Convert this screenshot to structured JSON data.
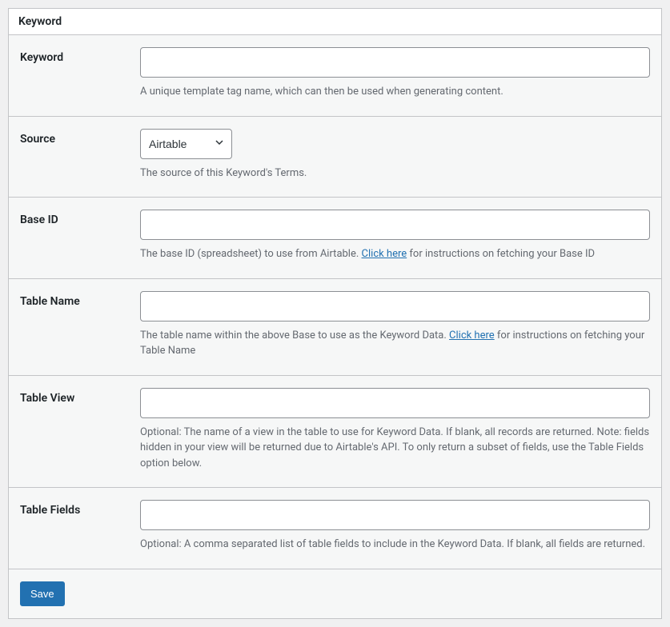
{
  "panel": {
    "title": "Keyword"
  },
  "fields": {
    "keyword": {
      "label": "Keyword",
      "value": "",
      "help": "A unique template tag name, which can then be used when generating content."
    },
    "source": {
      "label": "Source",
      "selected": "Airtable",
      "help": "The source of this Keyword's Terms."
    },
    "base_id": {
      "label": "Base ID",
      "value": "",
      "help_before": "The base ID (spreadsheet) to use from Airtable. ",
      "help_link": "Click here",
      "help_after": " for instructions on fetching your Base ID"
    },
    "table_name": {
      "label": "Table Name",
      "value": "",
      "help_before": "The table name within the above Base to use as the Keyword Data. ",
      "help_link": "Click here",
      "help_after": " for instructions on fetching your Table Name"
    },
    "table_view": {
      "label": "Table View",
      "value": "",
      "help": "Optional: The name of a view in the table to use for Keyword Data. If blank, all records are returned. Note: fields hidden in your view will be returned due to Airtable's API. To only return a subset of fields, use the Table Fields option below."
    },
    "table_fields": {
      "label": "Table Fields",
      "value": "",
      "help": "Optional: A comma separated list of table fields to include in the Keyword Data. If blank, all fields are returned."
    }
  },
  "actions": {
    "save": "Save"
  }
}
